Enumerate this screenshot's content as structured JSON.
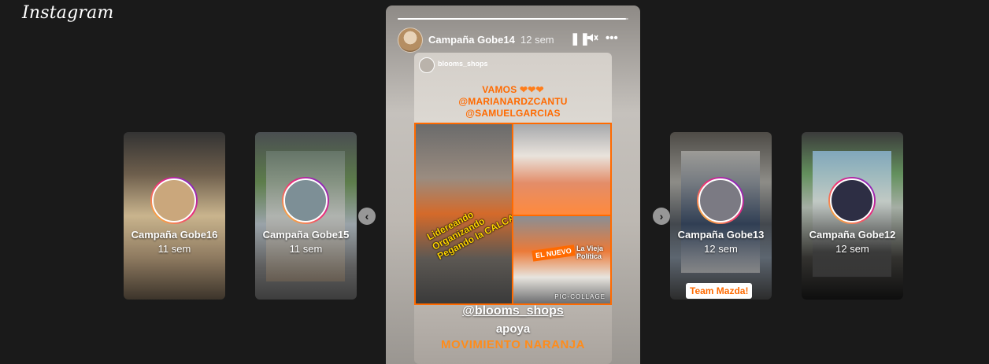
{
  "app": {
    "logo": "Instagram"
  },
  "stories_left": [
    {
      "name": "Campaña Gobe16",
      "time": "11 sem"
    },
    {
      "name": "Campaña Gobe15",
      "time": "11 sem"
    }
  ],
  "stories_right": [
    {
      "name": "Campaña Gobe13",
      "time": "12 sem",
      "tag": "Team Mazda!"
    },
    {
      "name": "Campaña Gobe12",
      "time": "12 sem"
    }
  ],
  "active_story": {
    "user": "Campaña Gobe14",
    "time": "12 sem",
    "progress": 0.99,
    "pause_icon": "pause-icon",
    "mute_icon": "muted-speaker-icon",
    "more_icon": "more-horizontal-icon",
    "repost_user": "blooms_shops",
    "header_lines": [
      "VAMOS",
      "@MARIANARDZCANTU",
      "@SAMUELGARCIAS"
    ],
    "slogan": [
      "Lidereando",
      "Organizando",
      "Pegando la CALCA"
    ],
    "photo_texts": {
      "nuevo": "EL NUEVO",
      "vieja": "La Vieja Política",
      "pic": "PIC-COLLAGE"
    },
    "mention": "@blooms_shops",
    "apoya": "apoya",
    "movimiento": "MOVIMIENTO NARANJA"
  },
  "nav": {
    "prev_icon": "chevron-left-icon",
    "next_icon": "chevron-right-icon"
  },
  "colors": {
    "accent_orange": "#ff6a00",
    "background": "#1a1a1a"
  }
}
